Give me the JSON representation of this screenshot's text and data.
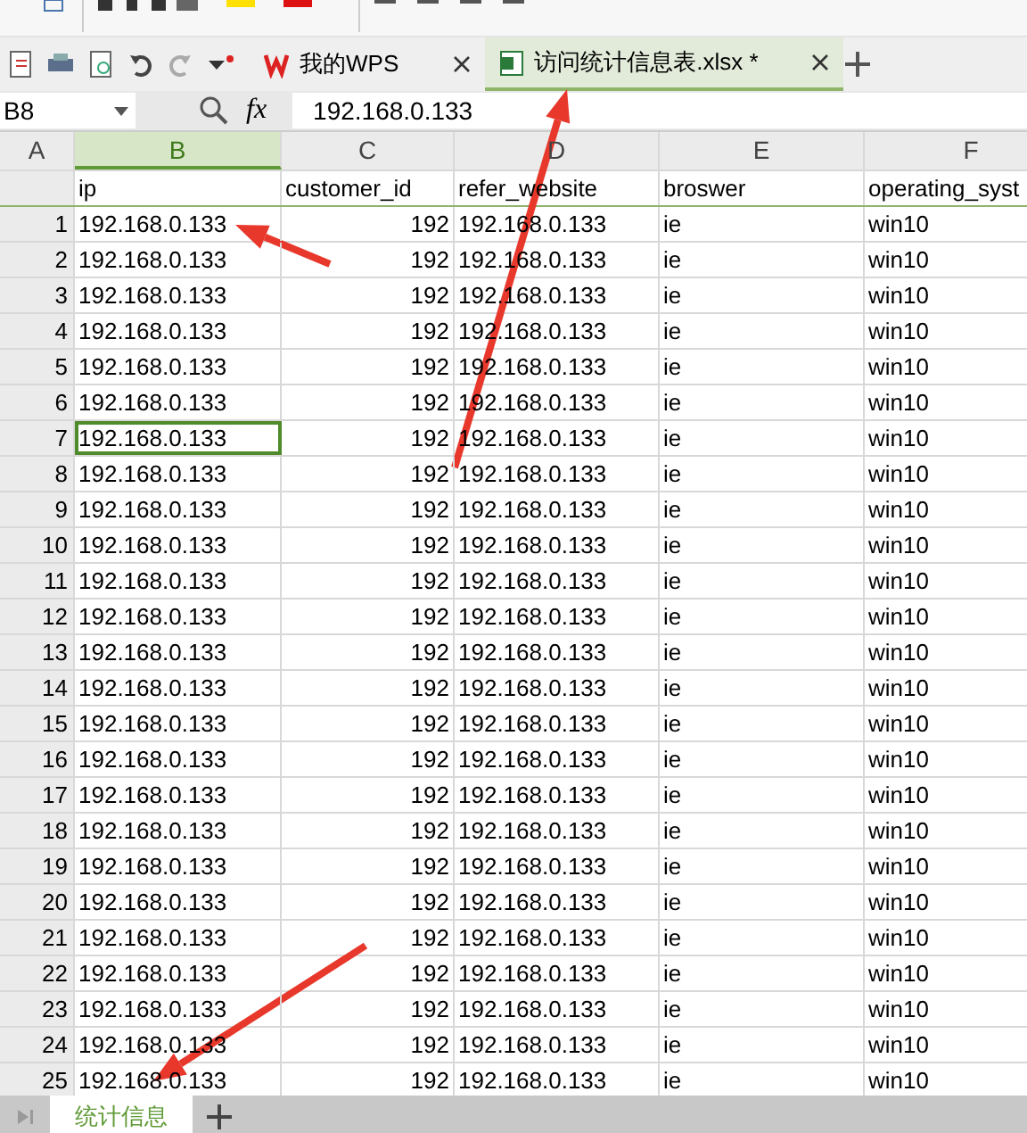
{
  "doc_tabs": [
    {
      "label": "我的WPS",
      "kind": "home",
      "selected": false
    },
    {
      "label": "访问统计信息表.xlsx *",
      "kind": "sheet",
      "selected": true
    }
  ],
  "name_box": "B8",
  "function_label": "fx",
  "formula": "192.168.0.133",
  "column_letters": [
    {
      "label": "A",
      "selected": false
    },
    {
      "label": "B",
      "selected": true
    },
    {
      "label": "C",
      "selected": false
    },
    {
      "label": "D",
      "selected": false
    },
    {
      "label": "E",
      "selected": false
    },
    {
      "label": "F",
      "selected": false
    }
  ],
  "header_row": [
    "ip",
    "customer_id",
    "refer_website",
    "broswer",
    "operating_syst"
  ],
  "rows": [
    {
      "number": "1",
      "cells": [
        "192.168.0.133",
        "192",
        "192.168.0.133",
        "ie",
        "win10"
      ],
      "active": false
    },
    {
      "number": "2",
      "cells": [
        "192.168.0.133",
        "192",
        "192.168.0.133",
        "ie",
        "win10"
      ],
      "active": false
    },
    {
      "number": "3",
      "cells": [
        "192.168.0.133",
        "192",
        "192.168.0.133",
        "ie",
        "win10"
      ],
      "active": false
    },
    {
      "number": "4",
      "cells": [
        "192.168.0.133",
        "192",
        "192.168.0.133",
        "ie",
        "win10"
      ],
      "active": false
    },
    {
      "number": "5",
      "cells": [
        "192.168.0.133",
        "192",
        "192.168.0.133",
        "ie",
        "win10"
      ],
      "active": false
    },
    {
      "number": "6",
      "cells": [
        "192.168.0.133",
        "192",
        "192.168.0.133",
        "ie",
        "win10"
      ],
      "active": false
    },
    {
      "number": "7",
      "cells": [
        "192.168.0.133",
        "192",
        "192.168.0.133",
        "ie",
        "win10"
      ],
      "active": true
    },
    {
      "number": "8",
      "cells": [
        "192.168.0.133",
        "192",
        "192.168.0.133",
        "ie",
        "win10"
      ],
      "active": false
    },
    {
      "number": "9",
      "cells": [
        "192.168.0.133",
        "192",
        "192.168.0.133",
        "ie",
        "win10"
      ],
      "active": false
    },
    {
      "number": "10",
      "cells": [
        "192.168.0.133",
        "192",
        "192.168.0.133",
        "ie",
        "win10"
      ],
      "active": false
    },
    {
      "number": "11",
      "cells": [
        "192.168.0.133",
        "192",
        "192.168.0.133",
        "ie",
        "win10"
      ],
      "active": false
    },
    {
      "number": "12",
      "cells": [
        "192.168.0.133",
        "192",
        "192.168.0.133",
        "ie",
        "win10"
      ],
      "active": false
    },
    {
      "number": "13",
      "cells": [
        "192.168.0.133",
        "192",
        "192.168.0.133",
        "ie",
        "win10"
      ],
      "active": false
    },
    {
      "number": "14",
      "cells": [
        "192.168.0.133",
        "192",
        "192.168.0.133",
        "ie",
        "win10"
      ],
      "active": false
    },
    {
      "number": "15",
      "cells": [
        "192.168.0.133",
        "192",
        "192.168.0.133",
        "ie",
        "win10"
      ],
      "active": false
    },
    {
      "number": "16",
      "cells": [
        "192.168.0.133",
        "192",
        "192.168.0.133",
        "ie",
        "win10"
      ],
      "active": false
    },
    {
      "number": "17",
      "cells": [
        "192.168.0.133",
        "192",
        "192.168.0.133",
        "ie",
        "win10"
      ],
      "active": false
    },
    {
      "number": "18",
      "cells": [
        "192.168.0.133",
        "192",
        "192.168.0.133",
        "ie",
        "win10"
      ],
      "active": false
    },
    {
      "number": "19",
      "cells": [
        "192.168.0.133",
        "192",
        "192.168.0.133",
        "ie",
        "win10"
      ],
      "active": false
    },
    {
      "number": "20",
      "cells": [
        "192.168.0.133",
        "192",
        "192.168.0.133",
        "ie",
        "win10"
      ],
      "active": false
    },
    {
      "number": "21",
      "cells": [
        "192.168.0.133",
        "192",
        "192.168.0.133",
        "ie",
        "win10"
      ],
      "active": false
    },
    {
      "number": "22",
      "cells": [
        "192.168.0.133",
        "192",
        "192.168.0.133",
        "ie",
        "win10"
      ],
      "active": false
    },
    {
      "number": "23",
      "cells": [
        "192.168.0.133",
        "192",
        "192.168.0.133",
        "ie",
        "win10"
      ],
      "active": false
    },
    {
      "number": "24",
      "cells": [
        "192.168.0.133",
        "192",
        "192.168.0.133",
        "ie",
        "win10"
      ],
      "active": false
    },
    {
      "number": "25",
      "cells": [
        "192.168.0.133",
        "192",
        "192.168.0.133",
        "ie",
        "win10"
      ],
      "active": false
    }
  ],
  "sheet_tabs": [
    {
      "label": "统计信息",
      "selected": true
    }
  ]
}
